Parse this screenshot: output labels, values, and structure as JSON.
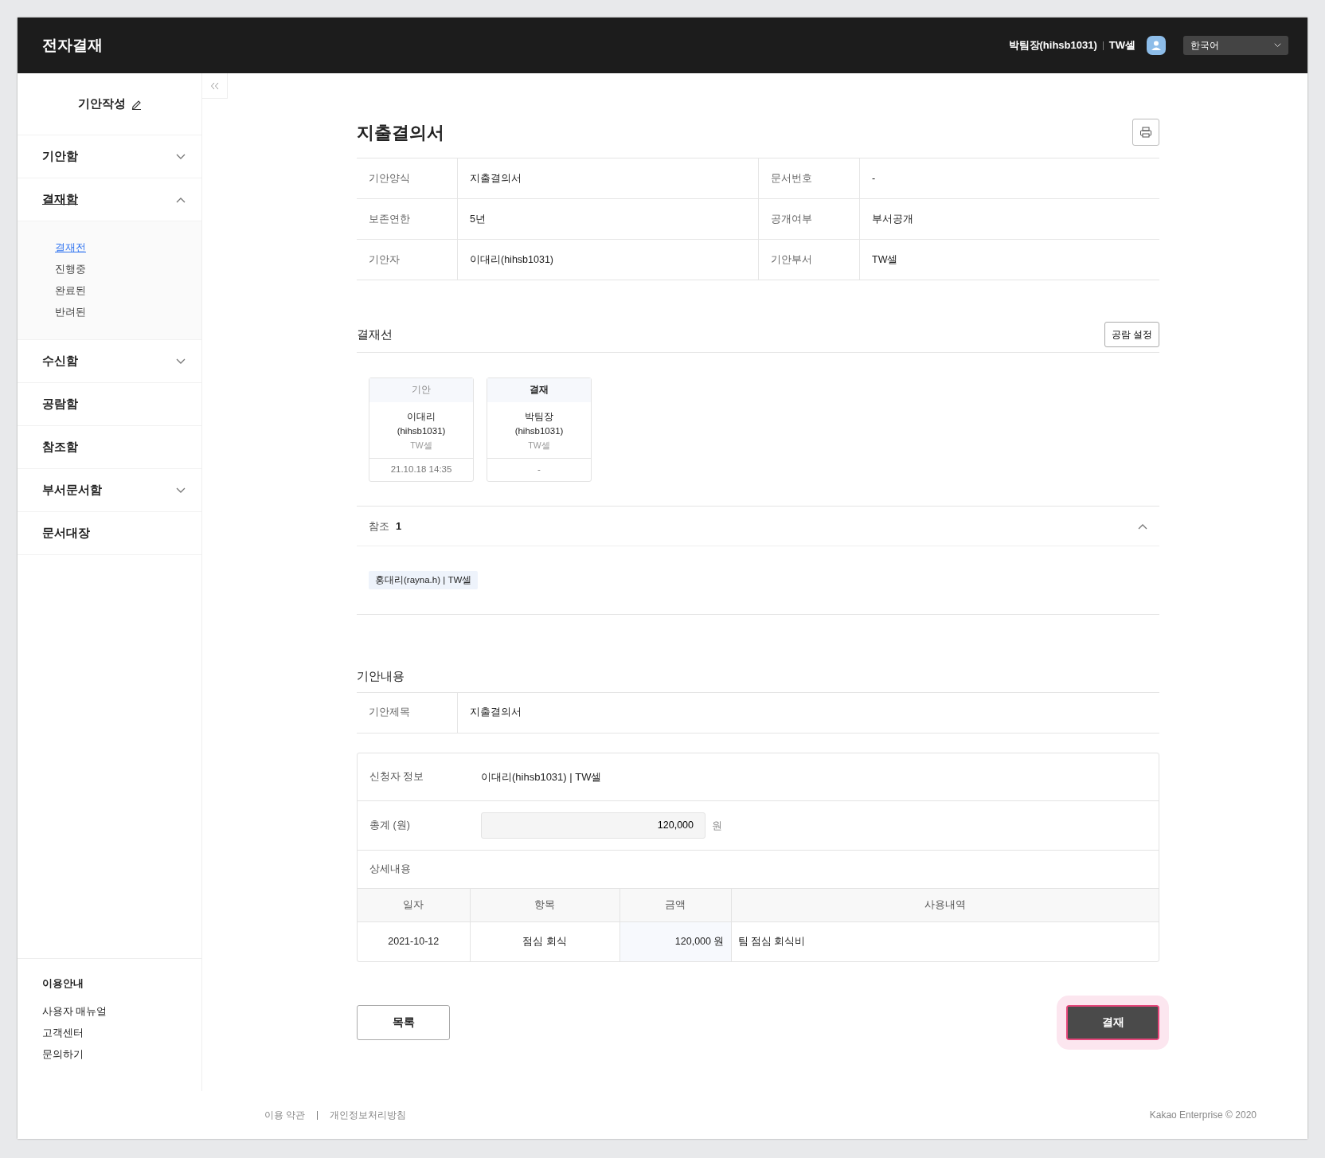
{
  "header": {
    "title": "전자결재",
    "user": "박팀장(hihsb1031)",
    "dept": "TW셀",
    "language": "한국어"
  },
  "sidebar": {
    "compose": "기안작성",
    "menu": [
      {
        "label": "기안함",
        "kind": "group",
        "expanded": false,
        "selected": false
      },
      {
        "label": "결재함",
        "kind": "group",
        "expanded": true,
        "selected": true,
        "children": [
          {
            "label": "결재전",
            "selected": true
          },
          {
            "label": "진행중",
            "selected": false
          },
          {
            "label": "완료된",
            "selected": false
          },
          {
            "label": "반려된",
            "selected": false
          }
        ]
      },
      {
        "label": "수신함",
        "kind": "group",
        "expanded": false,
        "selected": false
      },
      {
        "label": "공람함",
        "kind": "link",
        "selected": false
      },
      {
        "label": "참조함",
        "kind": "link",
        "selected": false
      },
      {
        "label": "부서문서함",
        "kind": "group",
        "expanded": false,
        "selected": false
      },
      {
        "label": "문서대장",
        "kind": "link",
        "selected": false
      }
    ],
    "help": {
      "title": "이용안내",
      "links": [
        "사용자 매뉴얼",
        "고객센터",
        "문의하기"
      ]
    }
  },
  "document": {
    "title": "지출결의서",
    "info": [
      {
        "label": "기안양식",
        "value": "지출결의서"
      },
      {
        "label": "문서번호",
        "value": "-"
      },
      {
        "label": "보존연한",
        "value": "5년"
      },
      {
        "label": "공개여부",
        "value": "부서공개"
      },
      {
        "label": "기안자",
        "value": "이대리(hihsb1031)"
      },
      {
        "label": "기안부서",
        "value": "TW셀"
      }
    ]
  },
  "approval_line": {
    "title": "결재선",
    "button": "공람 설정",
    "steps": [
      {
        "role": "기안",
        "name": "이대리",
        "id": "(hihsb1031)",
        "dept": "TW셀",
        "date": "21.10.18 14:35",
        "current": false
      },
      {
        "role": "결재",
        "name": "박팀장",
        "id": "(hihsb1031)",
        "dept": "TW셀",
        "date": "-",
        "current": true
      }
    ]
  },
  "reference": {
    "label": "참조",
    "count": "1",
    "expanded": true,
    "tags": [
      "홍대리(rayna.h) | TW셀"
    ]
  },
  "content": {
    "title": "기안내용",
    "fields": [
      {
        "label": "기안제목",
        "value": "지출결의서"
      }
    ],
    "form": {
      "applicant_label": "신청자 정보",
      "applicant": "이대리(hihsb1031) | TW셀",
      "total_label": "총계 (원)",
      "total": "120,000",
      "unit": "원",
      "detail_label": "상세내용",
      "columns": [
        "일자",
        "항목",
        "금액",
        "사용내역"
      ],
      "rows": [
        [
          "2021-10-12",
          "점심 회식",
          "120,000 원",
          "팀 점심 회식비"
        ]
      ]
    }
  },
  "buttons": [
    {
      "label": "목록",
      "kind": "secondary",
      "focused": false
    },
    {
      "label": "결재",
      "kind": "primary",
      "focused": true
    }
  ],
  "footer": {
    "links": [
      "이용 약관",
      "개인정보처리방침"
    ],
    "copyright": "Kakao Enterprise © 2020"
  }
}
